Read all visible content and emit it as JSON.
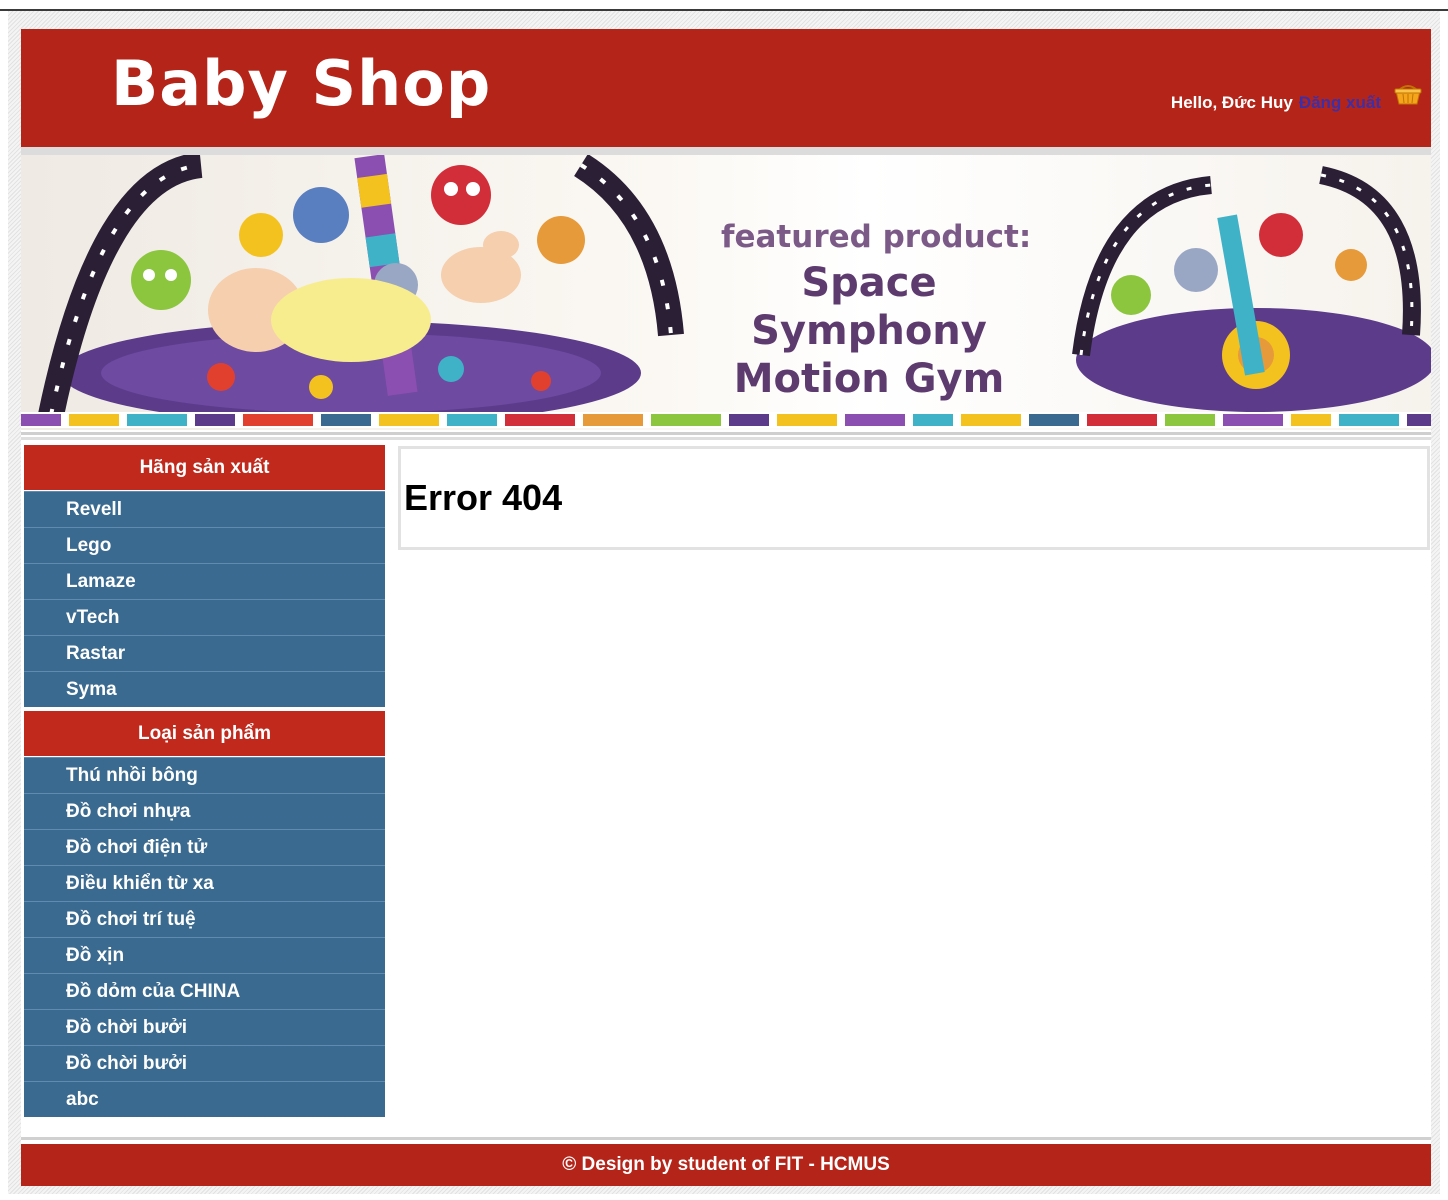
{
  "header": {
    "logo": "Baby Shop",
    "greeting": "Hello, Đức Huy",
    "logout_label": "Đăng xuất"
  },
  "banner": {
    "line1": "featured product:",
    "line2": "Space Symphony",
    "line3": "Motion Gym"
  },
  "sidebar": {
    "manufacturers_title": "Hãng sản xuất",
    "manufacturers": [
      "Revell",
      "Lego",
      "Lamaze",
      "vTech",
      "Rastar",
      "Syma"
    ],
    "categories_title": "Loại sản phẩm",
    "categories": [
      "Thú nhồi bông",
      "Đồ chơi nhựa",
      "Đồ chơi điện tử",
      "Điều khiển từ xa",
      "Đồ chơi trí tuệ",
      "Đồ xịn",
      "Đồ dỏm của CHINA",
      "Đồ chời bưởi",
      "Đồ chời bưởi",
      "abc"
    ]
  },
  "main": {
    "error_title": "Error 404"
  },
  "footer": {
    "text": "© Design by student of FIT - HCMUS"
  },
  "colors": {
    "brand_red": "#b52419",
    "sidebar_blue": "#3a6a8f",
    "logout_link": "#3d2fa8"
  }
}
